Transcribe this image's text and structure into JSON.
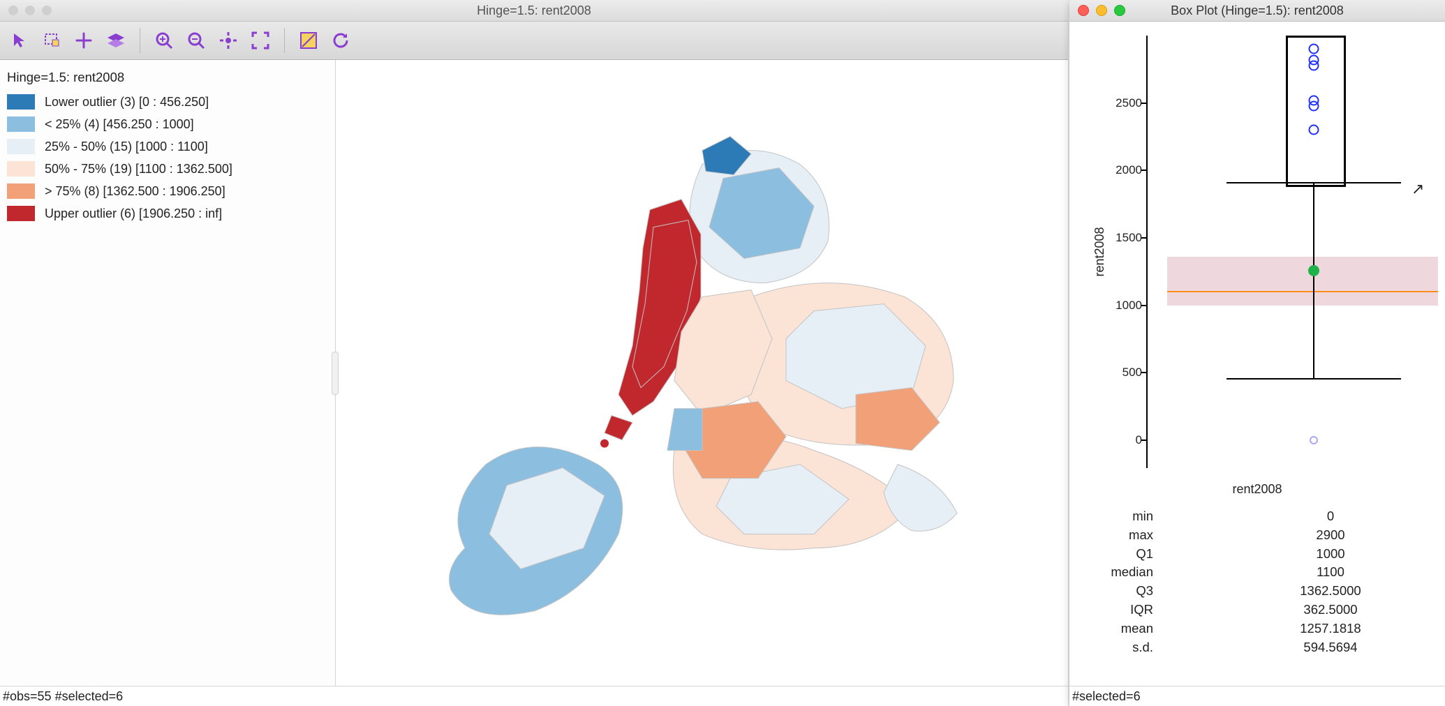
{
  "map_window": {
    "title": "Hinge=1.5: rent2008",
    "toolbar_icons": [
      "pointer",
      "select-rect",
      "pan",
      "layers",
      "zoom-in",
      "zoom-out",
      "zoom-extent",
      "fit",
      "brush",
      "refresh"
    ],
    "legend": {
      "title": "Hinge=1.5: rent2008",
      "items": [
        {
          "color": "#2c7bb6",
          "label": "Lower outlier (3)  [0 : 456.250]"
        },
        {
          "color": "#8cbee0",
          "label": "< 25% (4)  [456.250 : 1000]"
        },
        {
          "color": "#e6eff6",
          "label": "25% - 50% (15)  [1000 : 1100]"
        },
        {
          "color": "#fbe3d6",
          "label": "50% - 75% (19)  [1100 : 1362.500]"
        },
        {
          "color": "#f2a077",
          "label": "> 75% (8)  [1362.500 : 1906.250]"
        },
        {
          "color": "#c1282d",
          "label": "Upper outlier (6)  [1906.250 : inf]"
        }
      ]
    },
    "status": "#obs=55 #selected=6"
  },
  "plot_window": {
    "title": "Box Plot (Hinge=1.5): rent2008",
    "ylabel": "rent2008",
    "xlabel": "rent2008",
    "ticks": [
      0,
      500,
      1000,
      1500,
      2000,
      2500
    ],
    "outliers_upper": [
      2900,
      2820,
      2780,
      2520,
      2480,
      2300
    ],
    "outlier_lower": 0,
    "stats": [
      {
        "k": "min",
        "v": "0"
      },
      {
        "k": "max",
        "v": "2900"
      },
      {
        "k": "Q1",
        "v": "1000"
      },
      {
        "k": "median",
        "v": "1100"
      },
      {
        "k": "Q3",
        "v": "1362.5000"
      },
      {
        "k": "IQR",
        "v": "362.5000"
      },
      {
        "k": "mean",
        "v": "1257.1818"
      },
      {
        "k": "s.d.",
        "v": "594.5694"
      }
    ],
    "status": "#selected=6"
  },
  "chart_data": {
    "type": "boxplot",
    "variable": "rent2008",
    "hinge": 1.5,
    "min": 0,
    "max": 2900,
    "q1": 1000,
    "median": 1100,
    "q3": 1362.5,
    "iqr": 362.5,
    "mean": 1257.1818,
    "sd": 594.5694,
    "lower_fence": 456.25,
    "upper_fence": 1906.25,
    "upper_outliers": [
      2900,
      2820,
      2780,
      2520,
      2480,
      2300
    ],
    "lower_outliers": [
      0
    ],
    "y_ticks": [
      0,
      500,
      1000,
      1500,
      2000,
      2500
    ],
    "n_obs": 55,
    "n_selected": 6
  }
}
